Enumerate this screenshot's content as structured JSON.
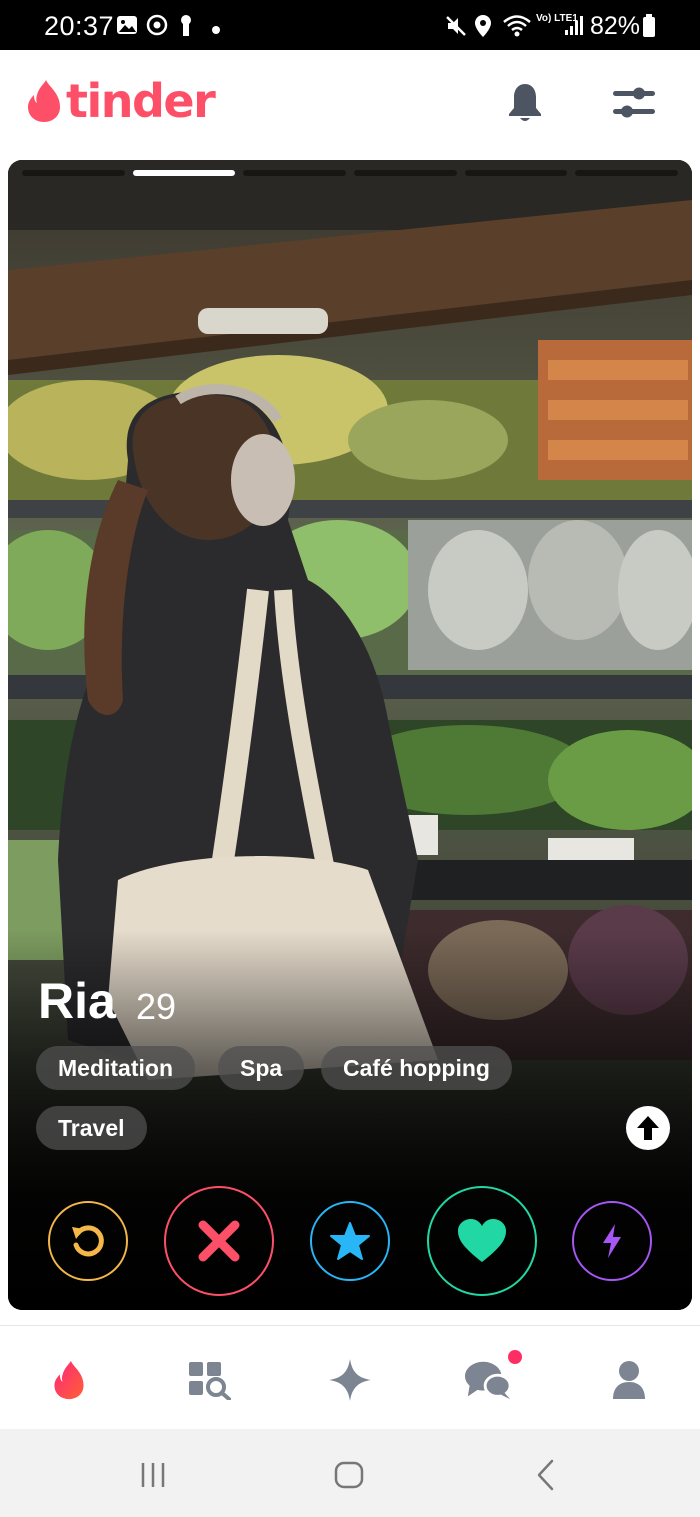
{
  "status_bar": {
    "time": "20:37",
    "network": "Vo) LTE1",
    "battery": "82%"
  },
  "header": {
    "logo_text": "tinder",
    "brand_color": "#fd5068",
    "icons": [
      "bell-icon",
      "filter-sliders-icon"
    ]
  },
  "profile": {
    "name": "Ria",
    "age": "29",
    "photo_count": 6,
    "active_photo": 2,
    "interests": [
      "Meditation",
      "Spa",
      "Café hopping",
      "Travel"
    ]
  },
  "actions": [
    {
      "name": "rewind",
      "icon": "rewind-icon",
      "color": "#f5b748"
    },
    {
      "name": "nope",
      "icon": "close-x-icon",
      "color": "#fd5068"
    },
    {
      "name": "super-like",
      "icon": "star-icon",
      "color": "#29b6f6"
    },
    {
      "name": "like",
      "icon": "heart-icon",
      "color": "#21d8a4"
    },
    {
      "name": "boost",
      "icon": "lightning-icon",
      "color": "#a657f5"
    }
  ],
  "bottom_nav": [
    "flame-icon",
    "explore-icon",
    "sparkle-icon",
    "chat-icon",
    "profile-icon"
  ],
  "system_nav": [
    "recents-icon",
    "home-icon",
    "back-icon"
  ]
}
